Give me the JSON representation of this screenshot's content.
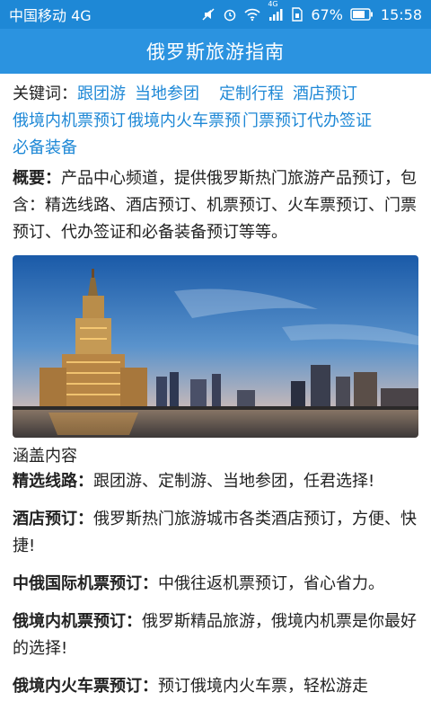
{
  "status_bar": {
    "carrier": "中国移动 4G",
    "network": "4G",
    "battery": "67%",
    "time": "15:58"
  },
  "header": {
    "title": "俄罗斯旅游指南"
  },
  "keywords": {
    "label": "关键词：",
    "items": [
      "跟团游",
      "当地参团",
      "定制行程",
      "酒店预订",
      "俄境内机票预订",
      "俄境内火车票预",
      "门票预订",
      "代办签证",
      "必备装备"
    ]
  },
  "summary": {
    "label": "概要：",
    "text": "产品中心频道，提供俄罗斯热门旅游产品预订，包含：精选线路、酒店预订、机票预订、火车票预订、门票预订、代办签证和必备装备预订等等。"
  },
  "coverage": {
    "title": "涵盖内容",
    "items": [
      {
        "label": "精选线路：",
        "text": "跟团游、定制游、当地参团，任君选择!"
      },
      {
        "label": "酒店预订：",
        "text": "俄罗斯热门旅游城市各类酒店预订，方便、快捷!"
      },
      {
        "label": "中俄国际机票预订：",
        "text": "中俄往返机票预订，省心省力。"
      },
      {
        "label": "俄境内机票预订：",
        "text": "俄罗斯精品旅游，俄境内机票是你最好的选择!"
      },
      {
        "label": "俄境内火车票预订：",
        "text": "预订俄境内火车票，轻松游走"
      }
    ]
  }
}
